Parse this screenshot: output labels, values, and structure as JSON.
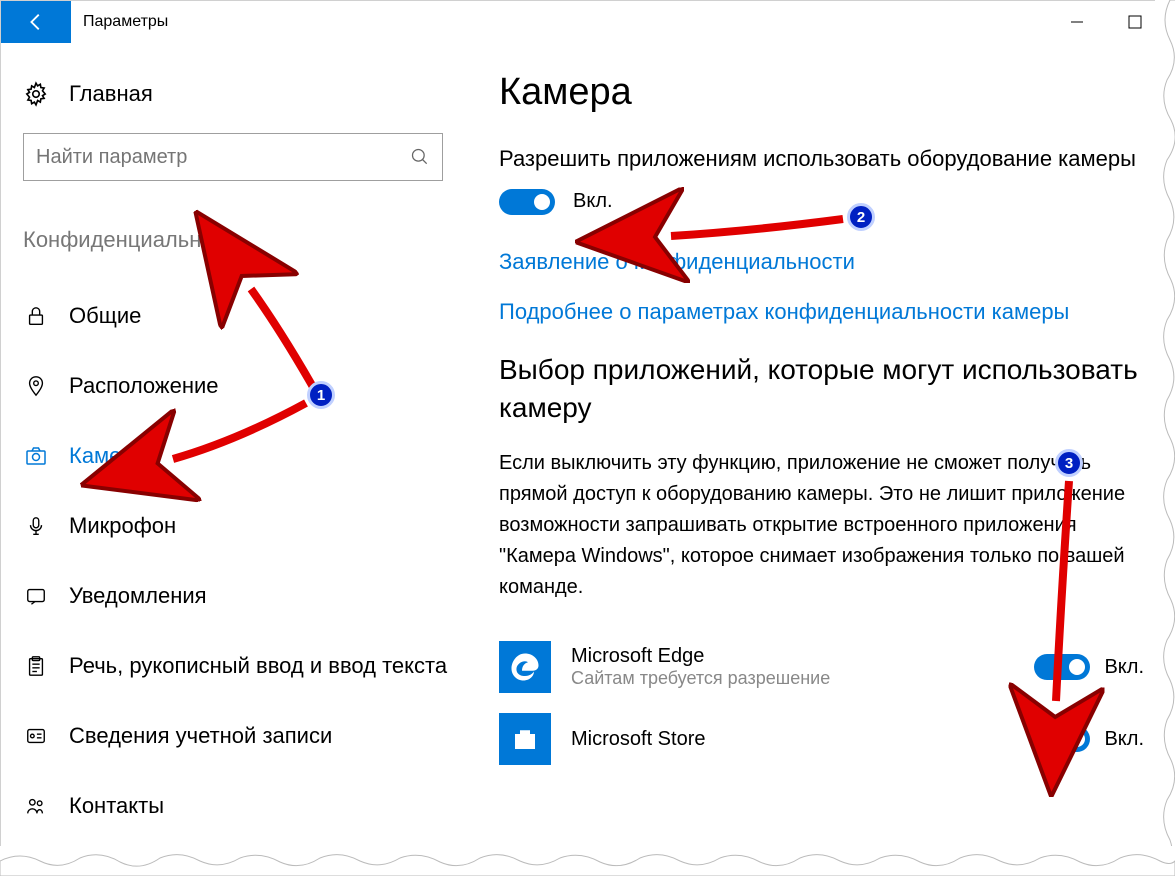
{
  "titlebar": {
    "title": "Параметры"
  },
  "sidebar": {
    "home_label": "Главная",
    "search_placeholder": "Найти параметр",
    "section_label": "Конфиденциальность",
    "items": [
      {
        "label": "Общие"
      },
      {
        "label": "Расположение"
      },
      {
        "label": "Камера"
      },
      {
        "label": "Микрофон"
      },
      {
        "label": "Уведомления"
      },
      {
        "label": "Речь, рукописный ввод и ввод текста"
      },
      {
        "label": "Сведения учетной записи"
      },
      {
        "label": "Контакты"
      }
    ]
  },
  "main": {
    "page_title": "Камера",
    "allow_text": "Разрешить приложениям использовать оборудование камеры",
    "toggle_state": "Вкл.",
    "link1": "Заявление о конфиденциальности",
    "link2": "Подробнее о параметрах конфиденциальности камеры",
    "choose_heading": "Выбор приложений, которые могут использовать камеру",
    "choose_desc": "Если выключить эту функцию, приложение не сможет получать прямой доступ к оборудованию камеры. Это не лишит приложение возможности запрашивать открытие встроенного приложения \"Камера Windows\", которое снимает изображения только по вашей команде.",
    "apps": [
      {
        "name": "Microsoft Edge",
        "sub": "Сайтам требуется разрешение",
        "state": "Вкл."
      },
      {
        "name": "Microsoft Store",
        "sub": "",
        "state": "Вкл."
      }
    ]
  },
  "annotations": {
    "badge1": "1",
    "badge2": "2",
    "badge3": "3"
  }
}
